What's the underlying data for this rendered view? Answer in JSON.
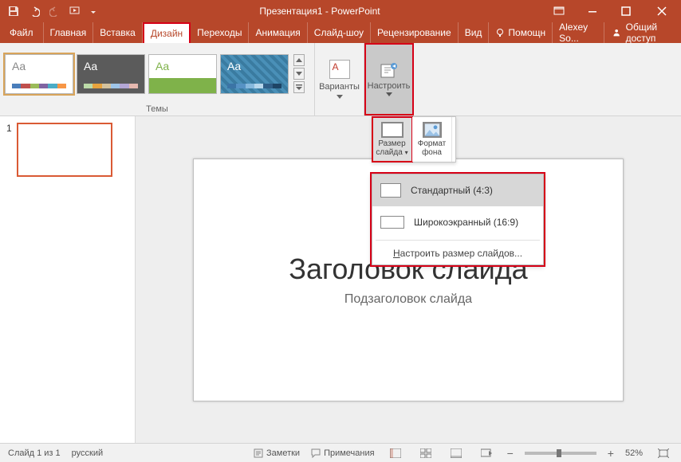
{
  "titlebar": {
    "title": "Презентация1 - PowerPoint"
  },
  "menubar": {
    "file": "Файл",
    "tabs": [
      "Главная",
      "Вставка",
      "Дизайн",
      "Переходы",
      "Анимация",
      "Слайд-шоу",
      "Рецензирование",
      "Вид"
    ],
    "active_index": 2,
    "help_label": "Помощн",
    "user": "Alexey So...",
    "share": "Общий доступ"
  },
  "ribbon": {
    "themes_label": "Темы",
    "variants_label": "Варианты",
    "customize_label": "Настроить"
  },
  "size_panel": {
    "size_label_1": "Размер",
    "size_label_2": "слайда",
    "format_label_1": "Формат",
    "format_label_2": "фона"
  },
  "size_menu": {
    "standard": "Стандартный (4:3)",
    "wide": "Широкоэкранный (16:9)",
    "custom_prefix": "Н",
    "custom_rest": "астроить размер слайдов..."
  },
  "slide": {
    "title": "Заголовок слайда",
    "subtitle": "Подзаголовок слайда",
    "thumb_number": "1"
  },
  "status": {
    "slide_count": "Слайд 1 из 1",
    "language": "русский",
    "notes": "Заметки",
    "comments": "Примечания",
    "zoom": "52%"
  },
  "colors": {
    "brand": "#b7472a",
    "highlight": "#d60017"
  }
}
